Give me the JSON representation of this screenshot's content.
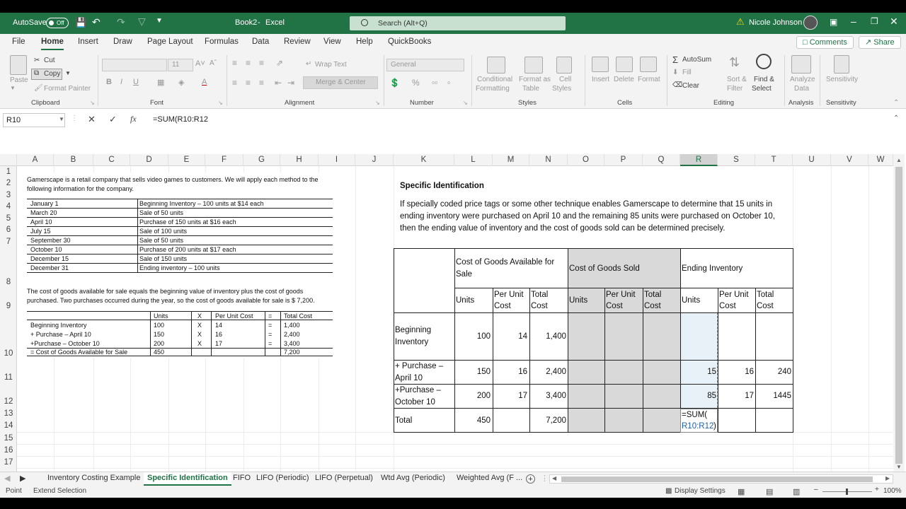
{
  "app": {
    "autosave": "AutoSave",
    "toggle": "Off",
    "doc": "Book2",
    "sep": "-",
    "appname": "Excel",
    "search": "Search (Alt+Q)",
    "user": "Nicole Johnson"
  },
  "menu": [
    "File",
    "Home",
    "Insert",
    "Draw",
    "Page Layout",
    "Formulas",
    "Data",
    "Review",
    "View",
    "Help",
    "QuickBooks"
  ],
  "comments": "Comments",
  "share": "Share",
  "ribbon": {
    "paste": "Paste",
    "cut": "Cut",
    "copy": "Copy",
    "format_painter": "Format Painter",
    "clipboard": "Clipboard",
    "font_size": "11",
    "font": "Font",
    "wrap": "Wrap Text",
    "merge": "Merge & Center",
    "alignment": "Alignment",
    "general": "General",
    "number": "Number",
    "cond1": "Conditional",
    "cond2": "Formatting",
    "fmt1": "Format as",
    "fmt2": "Table",
    "cell1": "Cell",
    "cell2": "Styles",
    "styles": "Styles",
    "insert": "Insert",
    "delete": "Delete",
    "format": "Format",
    "cells": "Cells",
    "autosum": "AutoSum",
    "fill": "Fill",
    "clear": "Clear",
    "sort1": "Sort &",
    "sort2": "Filter",
    "find1": "Find &",
    "find2": "Select",
    "editing": "Editing",
    "analyze1": "Analyze",
    "analyze2": "Data",
    "analysis": "Analysis",
    "sens": "Sensitivity",
    "sensitivity": "Sensitivity"
  },
  "formula": {
    "namebox": "R10",
    "content": "=SUM(R10:R12"
  },
  "columns": [
    "A",
    "B",
    "C",
    "D",
    "E",
    "F",
    "G",
    "H",
    "I",
    "J",
    "K",
    "L",
    "M",
    "N",
    "O",
    "P",
    "Q",
    "R",
    "S",
    "T",
    "U",
    "V",
    "W"
  ],
  "rows": [
    "1",
    "2",
    "3",
    "4",
    "5",
    "6",
    "7",
    "8",
    "9",
    "10",
    "11",
    "12",
    "13",
    "14",
    "15",
    "16",
    "17"
  ],
  "left": {
    "intro1": "Gamerscape is a retail company that sells video games to customers.  We will apply each method to the",
    "intro2": "following information for the company.",
    "events": [
      [
        "January 1",
        "Beginning Inventory – 100 units at $14 each"
      ],
      [
        "March 20",
        "Sale of 50 units"
      ],
      [
        "April 10",
        "Purchase of 150 units at $16 each"
      ],
      [
        "July 15",
        "Sale of 100 units"
      ],
      [
        "September 30",
        "Sale of 50 units"
      ],
      [
        "October 10",
        "Purchase of 200 units at $17 each"
      ],
      [
        "December 15",
        "Sale of 150 units"
      ],
      [
        "December 31",
        "Ending inventory – 100 units"
      ]
    ],
    "cogs1": "The cost of goods available for sale equals the beginning value of inventory plus the cost of goods",
    "cogs2": "purchased. Two purchases occurred during the year, so the cost of goods available for sale is $ 7,200.",
    "calc_head": [
      "Units",
      "X",
      "Per Unit Cost",
      "=",
      "Total Cost"
    ],
    "calc": [
      [
        "Beginning Inventory",
        "100",
        "X",
        "14",
        "=",
        "1,400"
      ],
      [
        "+ Purchase – April 10",
        "150",
        "X",
        "16",
        "=",
        "2,400"
      ],
      [
        "+Purchase – October 10",
        "200",
        "X",
        "17",
        "=",
        "3,400"
      ],
      [
        "= Cost of Goods Available for Sale",
        "450",
        "",
        "",
        "",
        "7,200"
      ]
    ]
  },
  "right": {
    "title": "Specific Identification",
    "p1": "If specially coded price tags or some other technique enables Gamerscape to determine that 15 units in",
    "p2": "ending inventory were purchased on April 10 and the remaining 85 units were purchased on October 10,",
    "p3": "then the ending value of inventory and the cost of goods sold can be determined precisely.",
    "h_cogas1": "Cost of Goods Available for",
    "h_cogas2": "Sale",
    "h_cogs": "Cost of Goods Sold",
    "h_end": "Ending Inventory",
    "units": "Units",
    "per1": "Per Unit",
    "per2": "Cost",
    "tot1": "Total",
    "tot2": "Cost",
    "r1a": "Beginning",
    "r1b": "Inventory",
    "r2a": "+ Purchase –",
    "r2b": "April 10",
    "r3a": "+Purchase –",
    "r3b": "October 10",
    "r4": "Total",
    "v": {
      "r1u": "100",
      "r1p": "14",
      "r1t": "1,400",
      "r2u": "150",
      "r2p": "16",
      "r2t": "2,400",
      "r3u": "200",
      "r3p": "17",
      "r3t": "3,400",
      "r4u": "450",
      "r4t": "7,200",
      "e2u": "15",
      "e2p": "16",
      "e2t": "240",
      "e3u": "85",
      "e3p": "17",
      "e3t": "1445"
    },
    "edit1": "=SUM(",
    "edit2": "R10:R12",
    "edit3": ")"
  },
  "tabs": [
    "Inventory Costing Example",
    "Specific Identification",
    "FIFO",
    "LIFO (Periodic)",
    "LIFO (Perpetual)",
    "Wtd Avg (Periodic)",
    "Weighted Avg (F ..."
  ],
  "status": {
    "mode": "Point",
    "ext": "Extend Selection",
    "display": "Display Settings",
    "zoom": "100%"
  },
  "colors": {
    "excel_green": "#217346",
    "selection_fill": "#e8f0f8",
    "gray_fill": "#d9d9d9",
    "ref_blue": "#1f5fa8"
  }
}
